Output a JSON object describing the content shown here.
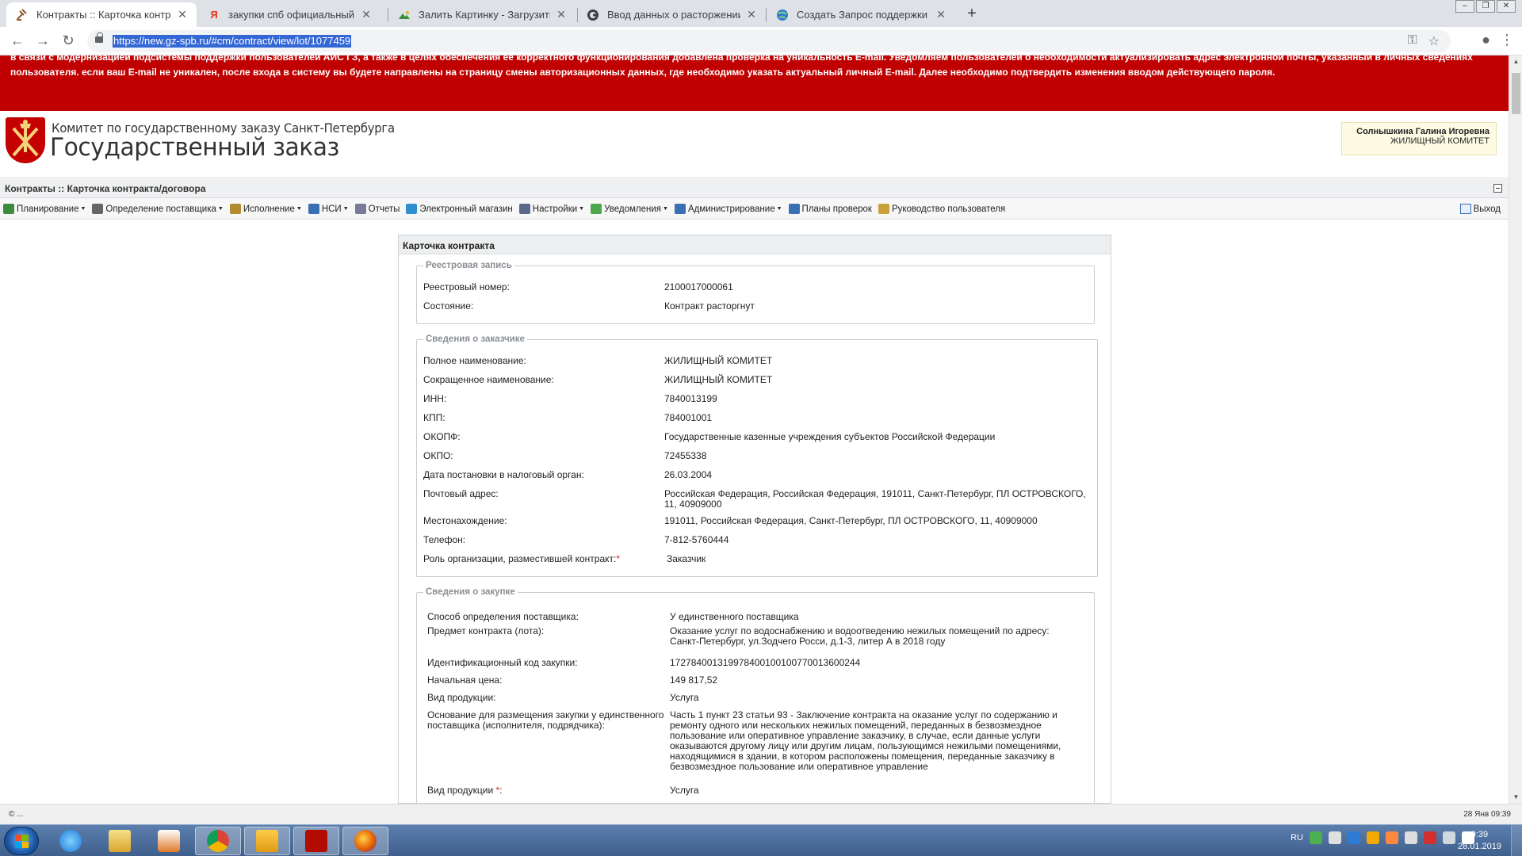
{
  "browser": {
    "tabs": [
      {
        "title": "Контракты :: Карточка контракт",
        "favicon": "scales-icon",
        "active": true
      },
      {
        "title": "закупки спб официальный сайт",
        "favicon": "yandex-icon",
        "active": false
      },
      {
        "title": "Залить Картинку - Загрузить фо",
        "favicon": "image-host-icon",
        "active": false
      },
      {
        "title": "Ввод данных о расторжении ко",
        "favicon": "google-icon",
        "active": false
      },
      {
        "title": "Создать Запрос поддержки - AI",
        "favicon": "globe-icon",
        "active": false
      }
    ],
    "url": "https://new.gz-spb.ru/#cm/contract/view/lot/1077459"
  },
  "banner": {
    "text": "в связи с модернизацией подсистемы поддержки пользователей АИС ГЗ, а также в целях обеспечения ее корректного функционирования добавлена проверка на уникальность E-mail. Уведомляем пользователей о необходимости актуализировать адрес электронной почты, указанный в личных сведениях пользователя. если ваш E-mail не уникален, после входа в систему вы будете направлены на страницу смены авторизационных данных, где необходимо указать актуальный личный E-mail. Далее необходимо подтвердить изменения вводом действующего пароля."
  },
  "header": {
    "org_line1": "Комитет по государственному заказу Санкт-Петербурга",
    "org_line2": "Государственный заказ",
    "user_name": "Солнышкина Галина Игоревна",
    "user_org": "ЖИЛИЩНЫЙ КОМИТЕТ"
  },
  "breadcrumb": "Контракты :: Карточка контракта/договора",
  "menu": {
    "items": [
      {
        "label": "Планирование",
        "dropdown": true,
        "icon_color": "#3d8b3d"
      },
      {
        "label": "Определение поставщика",
        "dropdown": true,
        "icon_color": "#666666"
      },
      {
        "label": "Исполнение",
        "dropdown": true,
        "icon_color": "#b38b2e"
      },
      {
        "label": "НСИ",
        "dropdown": true,
        "icon_color": "#3a6fb4"
      },
      {
        "label": "Отчеты",
        "dropdown": false,
        "icon_color": "#7a7a9a"
      },
      {
        "label": "Электронный магазин",
        "dropdown": false,
        "icon_color": "#2e8fcf"
      },
      {
        "label": "Настройки",
        "dropdown": true,
        "icon_color": "#5a6a88"
      },
      {
        "label": "Уведомления",
        "dropdown": true,
        "icon_color": "#4ca64c"
      },
      {
        "label": "Администрирование",
        "dropdown": true,
        "icon_color": "#3a6fb4"
      },
      {
        "label": "Планы проверок",
        "dropdown": false,
        "icon_color": "#3a6fb4"
      },
      {
        "label": "Руководство пользователя",
        "dropdown": false,
        "icon_color": "#c9a03a"
      }
    ],
    "logout_label": "Выход"
  },
  "card": {
    "title": "Карточка контракта",
    "registry": {
      "legend": "Реестровая запись",
      "registry_number_label": "Реестровый номер:",
      "registry_number": "2100017000061",
      "state_label": "Состояние:",
      "state": "Контракт расторгнут"
    },
    "customer": {
      "legend": "Сведения о заказчике",
      "full_name_label": "Полное наименование:",
      "full_name": "ЖИЛИЩНЫЙ КОМИТЕТ",
      "short_name_label": "Сокращенное наименование:",
      "short_name": "ЖИЛИЩНЫЙ КОМИТЕТ",
      "inn_label": "ИНН:",
      "inn": "7840013199",
      "kpp_label": "КПП:",
      "kpp": "784001001",
      "okopf_label": "ОКОПФ:",
      "okopf": "Государственные казенные учреждения субъектов Российской Федерации",
      "okpo_label": "ОКПО:",
      "okpo": "72455338",
      "tax_date_label": "Дата постановки в налоговый орган:",
      "tax_date": "26.03.2004",
      "postal_label": "Почтовый адрес:",
      "postal_line1": "Российская Федерация, Российская Федерация, 191011, Санкт-Петербург, ПЛ ОСТРОВСКОГО,",
      "postal_line2": "11, 40909000",
      "location_label": "Местонахождение:",
      "location": "191011, Российская Федерация, Санкт-Петербург, ПЛ ОСТРОВСКОГО, 11, 40909000",
      "phone_label": "Телефон:",
      "phone": "7-812-5760444",
      "role_label": "Роль организации, разместившей контракт:",
      "role": "Заказчик"
    },
    "purchase": {
      "legend": "Сведения о закупке",
      "method_label": "Способ определения поставщика:",
      "method": "У единственного поставщика",
      "subject_label": "Предмет контракта (лота):",
      "subject_line1": "Оказание услуг по водоснабжению и водоотведению нежилых помещений по адресу:",
      "subject_line2": "Санкт-Петербург, ул.Зодчего Росси, д.1-3, литер А в 2018 году",
      "ikz_label": "Идентификационный код закупки:",
      "ikz": "172784001319978400100100770013600244",
      "price_label": "Начальная цена:",
      "price": "149 817,52",
      "product_type_label": "Вид продукции:",
      "product_type": "Услуга",
      "basis_label_line1": "Основание для размещения закупки у единственного",
      "basis_label_line2": "поставщика (исполнителя, подрядчика):",
      "basis_lines": [
        "Часть 1 пункт 23 статьи 93 - Заключение контракта на оказание услуг по содержанию и",
        "ремонту одного или нескольких нежилых помещений, переданных в безвозмездное",
        "пользование или оперативное управление заказчику, в случае, если данные услуги",
        "оказываются другому лицу или другим лицам, пользующимся нежилыми помещениями,",
        "находящимися в здании, в котором расположены помещения, переданные заказчику в",
        "безвозмездное пользование или оперативное управление"
      ],
      "product_type2_label": "Вид продукции",
      "product_type2": "Услуга"
    }
  },
  "statusbar": {
    "left": "...",
    "right": "28 Янв 09:39"
  },
  "taskbar": {
    "lang": "RU",
    "time": "9:39",
    "date": "28.01.2019"
  }
}
